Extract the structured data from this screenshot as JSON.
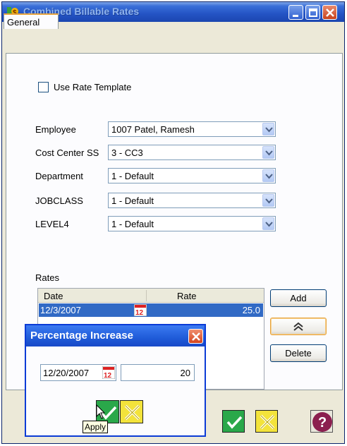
{
  "window": {
    "title": "Combined Billable Rates"
  },
  "tabs": [
    {
      "label": "General",
      "active": true
    }
  ],
  "form": {
    "use_rate_template": {
      "label": "Use Rate Template",
      "checked": false
    },
    "fields": [
      {
        "label": "Employee",
        "value": "1007 Patel, Ramesh"
      },
      {
        "label": "Cost Center SS",
        "value": "3 - CC3"
      },
      {
        "label": "Department",
        "value": "1 - Default"
      },
      {
        "label": "JOBCLASS",
        "value": "1 - Default"
      },
      {
        "label": "LEVEL4",
        "value": "1 - Default"
      }
    ]
  },
  "rates": {
    "label": "Rates",
    "columns": [
      "Date",
      "Rate"
    ],
    "rows": [
      {
        "date": "12/3/2007",
        "rate": "25.0",
        "selected": true
      }
    ],
    "buttons": {
      "add": "Add",
      "move_up": "",
      "delete": "Delete"
    }
  },
  "dialog": {
    "title": "Percentage Increase",
    "date_value": "12/20/2007",
    "percent_value": "20",
    "tooltip": "Apply"
  },
  "icons": {
    "title": "app-icon",
    "calendar": "calendar-icon",
    "ok": "checkmark-icon",
    "cancel": "x-icon",
    "help": "question-mark-icon"
  },
  "colors": {
    "ok_green": "#2aa84a",
    "cancel_yellow": "#f3e33b",
    "selection_blue": "#316ac5",
    "title_blue": "#2453c4",
    "focus_orange": "#e6a23c"
  }
}
